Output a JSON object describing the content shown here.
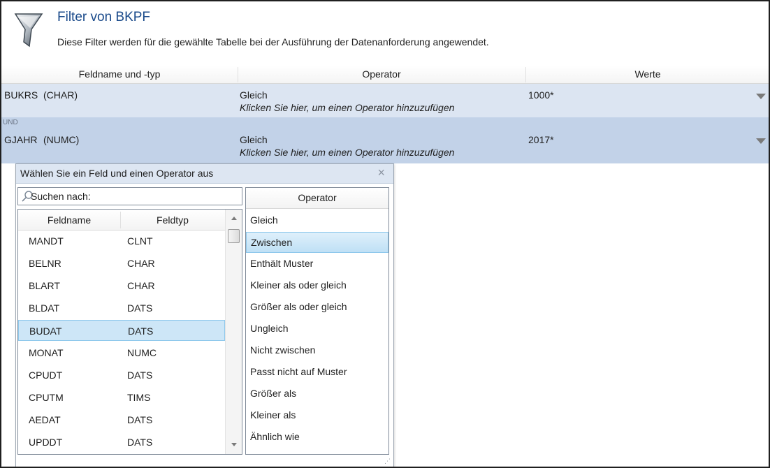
{
  "header": {
    "title": "Filter von BKPF",
    "subtitle": "Diese Filter werden für die gewählte Tabelle bei der Ausführung der Datenanforderung angewendet."
  },
  "table": {
    "columns": [
      "Feldname und -typ",
      "Operator",
      "Werte"
    ],
    "rows": [
      {
        "field": "BUKRS",
        "type": "(CHAR)",
        "operator": "Gleich",
        "add_operator_hint": "Klicken Sie hier, um einen Operator hinzuzufügen",
        "value": "1000*"
      },
      {
        "connector": "UND",
        "field": "GJAHR",
        "type": "(NUMC)",
        "operator": "Gleich",
        "add_operator_hint": "Klicken Sie hier, um einen Operator hinzuzufügen",
        "value": "2017*"
      }
    ]
  },
  "popup": {
    "title": "Wählen Sie ein Feld und einen Operator aus",
    "close": "×",
    "search_label": "Suchen nach:",
    "field_list": {
      "headers": [
        "Feldname",
        "Feldtyp"
      ],
      "rows": [
        {
          "name": "MANDT",
          "type": "CLNT"
        },
        {
          "name": "BELNR",
          "type": "CHAR"
        },
        {
          "name": "BLART",
          "type": "CHAR"
        },
        {
          "name": "BLDAT",
          "type": "DATS"
        },
        {
          "name": "BUDAT",
          "type": "DATS"
        },
        {
          "name": "MONAT",
          "type": "NUMC"
        },
        {
          "name": "CPUDT",
          "type": "DATS"
        },
        {
          "name": "CPUTM",
          "type": "TIMS"
        },
        {
          "name": "AEDAT",
          "type": "DATS"
        },
        {
          "name": "UPDDT",
          "type": "DATS"
        }
      ],
      "selected_index": 4
    },
    "operator_list": {
      "header": "Operator",
      "items": [
        "Gleich",
        "Zwischen",
        "Enthält Muster",
        "Kleiner als oder gleich",
        "Größer als oder gleich",
        "Ungleich",
        "Nicht zwischen",
        "Passt nicht auf Muster",
        "Größer als",
        "Kleiner als",
        "Ähnlich wie"
      ],
      "selected_index": 1
    }
  },
  "colors": {
    "title": "#1a4a8a",
    "row_light": "#dce5f2",
    "row_selected": "#c2d2e8",
    "list_selection": "#cde6f7"
  }
}
